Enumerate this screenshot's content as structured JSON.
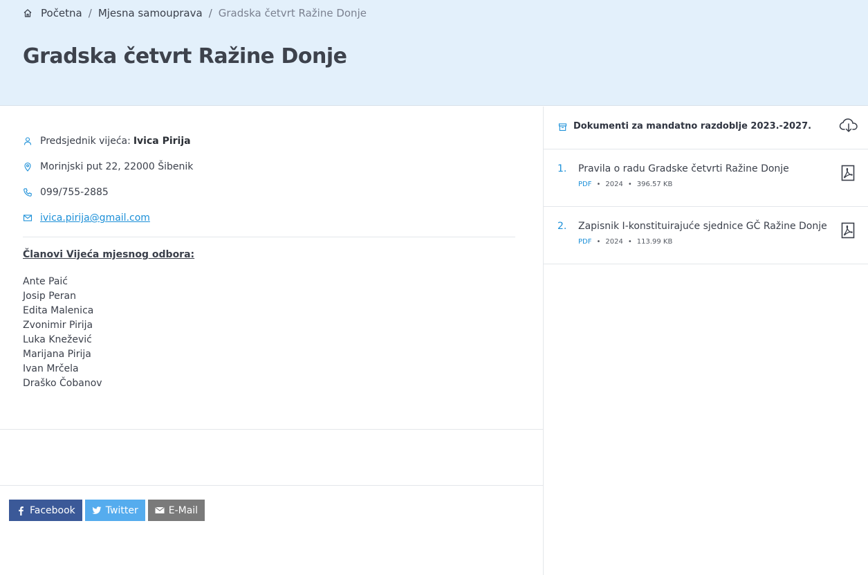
{
  "breadcrumb": {
    "home": "Početna",
    "section": "Mjesna samouprava",
    "current": "Gradska četvrt Ražine Donje"
  },
  "page": {
    "title": "Gradska četvrt Ražine Donje"
  },
  "info": {
    "president_label": "Predsjednik vijeća:",
    "president_name": "Ivica Pirija",
    "address": "Morinjski put 22, 22000 Šibenik",
    "phone": "099/755-2885",
    "email": "ivica.pirija@gmail.com"
  },
  "members": {
    "heading": "Članovi Vijeća mjesnog odbora:",
    "list": [
      "Ante Paić",
      "Josip Peran",
      "Edita Malenica",
      "Zvonimir Pirija",
      "Luka Knežević",
      "Marijana Pirija",
      "Ivan Mrčela",
      "Draško Čobanov"
    ]
  },
  "share": {
    "facebook": "Facebook",
    "twitter": "Twitter",
    "email": "E-Mail"
  },
  "documents": {
    "heading": "Dokumenti za mandatno razdoblje 2023.-2027.",
    "items": [
      {
        "num": "1.",
        "name": "Pravila o radu Gradske četvrti Ražine Donje",
        "type": "PDF",
        "year": "2024",
        "size": "396.57 KB"
      },
      {
        "num": "2.",
        "name": "Zapisnik I-konstituirajuće sjednice GČ Ražine Donje",
        "type": "PDF",
        "year": "2024",
        "size": "113.99 KB"
      }
    ]
  },
  "colors": {
    "hero_bg": "#e3f0fb",
    "accent": "#1b8fd8",
    "facebook": "#3b5998",
    "twitter": "#55acee",
    "email": "#7a7a7a"
  },
  "icons": [
    "home-icon",
    "user-icon",
    "location-pin-icon",
    "phone-icon",
    "mail-icon",
    "archive-icon",
    "cloud-download-icon",
    "pdf-icon",
    "facebook-icon",
    "twitter-icon",
    "envelope-icon"
  ]
}
